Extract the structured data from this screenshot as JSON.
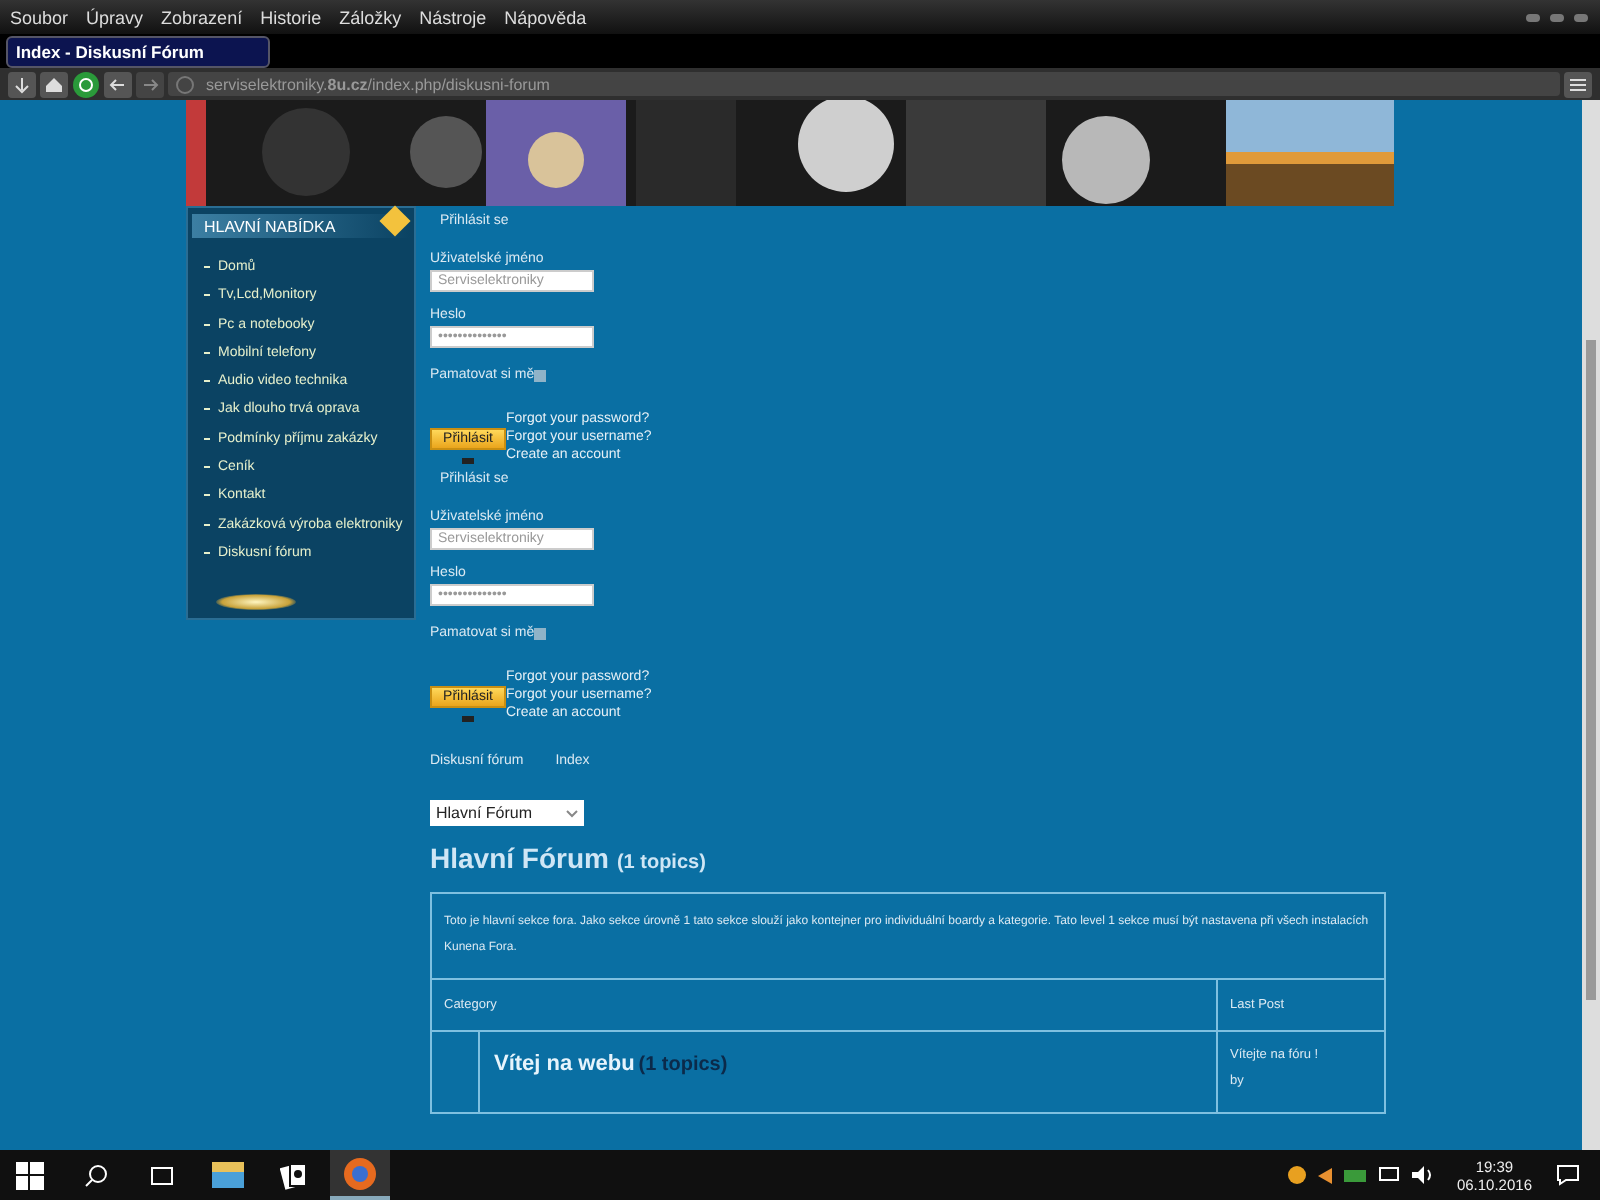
{
  "menu_bar": [
    "Soubor",
    "Úpravy",
    "Zobrazení",
    "Historie",
    "Záložky",
    "Nástroje",
    "Nápověda"
  ],
  "tab": {
    "title": "Index - Diskusní Fórum",
    "selected": true
  },
  "address_bar": {
    "url": "serviselektroniky.**8u.cz**/index.php/diskusni-forum"
  },
  "sidebar": {
    "title": "HLAVNÍ NABÍDKA",
    "items": [
      {
        "label": "Domů"
      },
      {
        "label": "Tv,Lcd,Monitory"
      },
      {
        "label": "Pc a notebooky"
      },
      {
        "label": "Mobilní telefony"
      },
      {
        "label": "Audio video technika"
      },
      {
        "label": "Jak dlouho trvá oprava"
      },
      {
        "label": "Podmínky příjmu zakázky"
      },
      {
        "label": "Ceník"
      },
      {
        "label": "Kontakt"
      },
      {
        "label": "Zakázková výroba elektroniky"
      },
      {
        "label": "Diskusní fórum"
      }
    ]
  },
  "login_forms": [
    {
      "heading": "Přihlásit se",
      "username_label": "Uživatelské jméno",
      "username": "Serviselektroniky",
      "password_label": "Heslo",
      "password": "••••••••••••••",
      "remember_label": "Pamatovat si mě",
      "remember": false,
      "button": "Přihlásit",
      "links": [
        "Forgot your password?",
        "Forgot your username?",
        "Create an account"
      ]
    },
    {
      "heading": "Přihlásit se",
      "username_label": "Uživatelské jméno",
      "username": "Serviselektroniky",
      "password_label": "Heslo",
      "password": "••••••••••••••",
      "remember_label": "Pamatovat si mě",
      "remember": false,
      "button": "Přihlásit",
      "links": [
        "Forgot your password?",
        "Forgot your username?",
        "Create an account"
      ]
    }
  ],
  "breadcrumbs": [
    "Diskusní fórum",
    "Index"
  ],
  "forum_select": {
    "value": "Hlavní Fórum"
  },
  "forum": {
    "title": "Hlavní Fórum",
    "count": "(1 topics)",
    "description": "Toto je hlavní sekce fora. Jako sekce úrovně 1 tato sekce slouží jako kontejner pro individuální boardy a kategorie. Tato level 1 sekce musí být nastavena při všech instalacích Kunena Fora.",
    "columns": [
      "Category",
      "Last Post"
    ],
    "rows": [
      {
        "title": "Vítej na webu",
        "count": "(1 topics)",
        "last_post": "Vítejte na fóru !",
        "by": "by"
      }
    ]
  },
  "taskbar": {
    "time": "19:39",
    "date": "06.10.2016"
  }
}
